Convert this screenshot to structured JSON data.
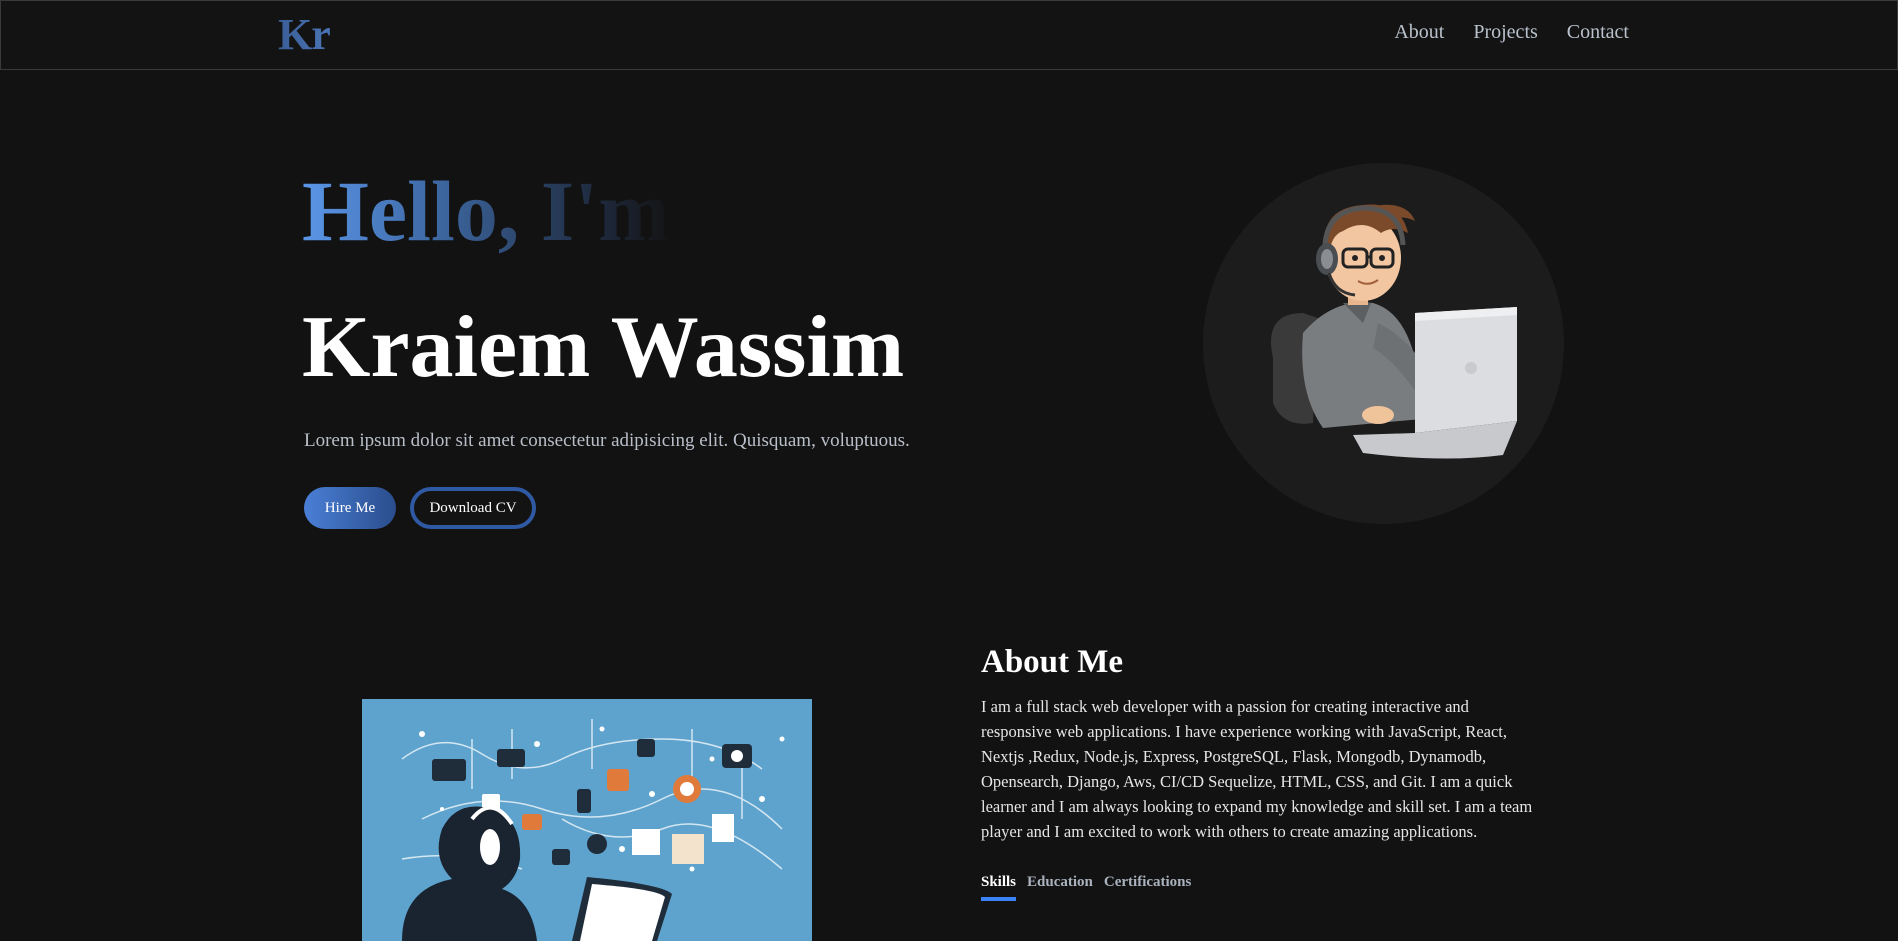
{
  "nav": {
    "logo": "Kr",
    "links": [
      "About",
      "Projects",
      "Contact"
    ]
  },
  "hero": {
    "greeting": "Hello, I'm",
    "name": "Kraiem Wassim",
    "tagline": "Lorem ipsum dolor sit amet consectetur adipisicing elit. Quisquam, voluptuous.",
    "hire_label": "Hire Me",
    "cv_label": "Download CV"
  },
  "about": {
    "title": "About Me",
    "text": "I am a full stack web developer with a passion for creating interactive and responsive web applications. I have experience working with JavaScript, React, Nextjs ,Redux, Node.js, Express, PostgreSQL, Flask, Mongodb, Dynamodb, Opensearch, Django, Aws, CI/CD Sequelize, HTML, CSS, and Git. I am a quick learner and I am always looking to expand my knowledge and skill set. I am a team player and I am excited to work with others to create amazing applications.",
    "tabs": [
      "Skills",
      "Education",
      "Certifications"
    ],
    "active_tab": "Skills"
  },
  "colors": {
    "background": "#121212",
    "accent": "#3b82f6",
    "accent_dark": "#2a4d8c"
  }
}
